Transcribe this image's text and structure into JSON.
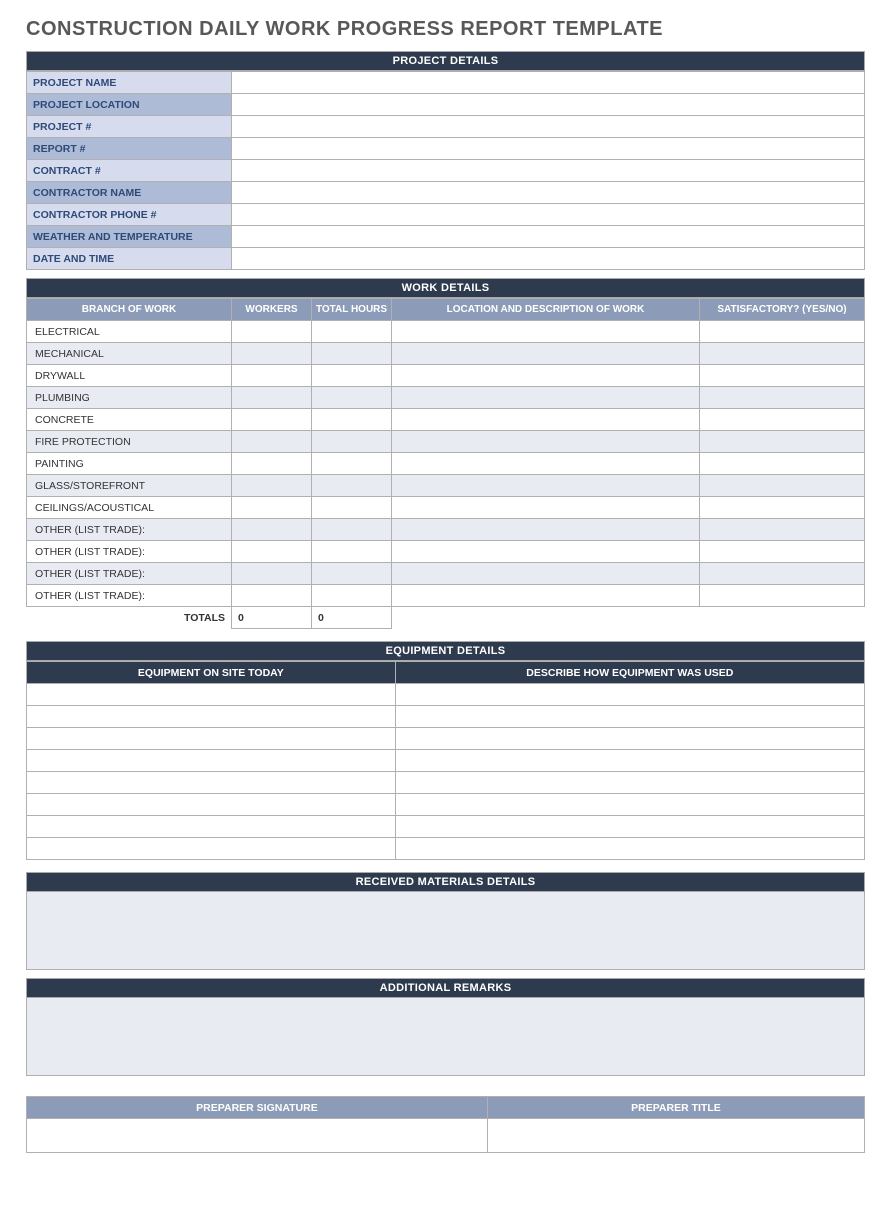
{
  "title": "CONSTRUCTION DAILY WORK PROGRESS REPORT TEMPLATE",
  "sections": {
    "project": "PROJECT DETAILS",
    "work": "WORK DETAILS",
    "equipment": "EQUIPMENT DETAILS",
    "materials": "RECEIVED MATERIALS DETAILS",
    "remarks": "ADDITIONAL REMARKS"
  },
  "project_fields": [
    {
      "label": "PROJECT NAME",
      "value": ""
    },
    {
      "label": "PROJECT LOCATION",
      "value": ""
    },
    {
      "label": "PROJECT #",
      "value": ""
    },
    {
      "label": "REPORT #",
      "value": ""
    },
    {
      "label": "CONTRACT #",
      "value": ""
    },
    {
      "label": "CONTRACTOR NAME",
      "value": ""
    },
    {
      "label": "CONTRACTOR PHONE #",
      "value": ""
    },
    {
      "label": "WEATHER AND TEMPERATURE",
      "value": ""
    },
    {
      "label": "DATE AND TIME",
      "value": ""
    }
  ],
  "work_columns": {
    "branch": "BRANCH OF WORK",
    "workers": "WORKERS",
    "hours": "TOTAL HOURS",
    "location": "LOCATION AND DESCRIPTION OF WORK",
    "satisfactory": "SATISFACTORY? (YES/NO)"
  },
  "work_rows": [
    {
      "branch": "ELECTRICAL",
      "workers": "",
      "hours": "",
      "location": "",
      "satisfactory": ""
    },
    {
      "branch": "MECHANICAL",
      "workers": "",
      "hours": "",
      "location": "",
      "satisfactory": ""
    },
    {
      "branch": "DRYWALL",
      "workers": "",
      "hours": "",
      "location": "",
      "satisfactory": ""
    },
    {
      "branch": "PLUMBING",
      "workers": "",
      "hours": "",
      "location": "",
      "satisfactory": ""
    },
    {
      "branch": "CONCRETE",
      "workers": "",
      "hours": "",
      "location": "",
      "satisfactory": ""
    },
    {
      "branch": "FIRE PROTECTION",
      "workers": "",
      "hours": "",
      "location": "",
      "satisfactory": ""
    },
    {
      "branch": "PAINTING",
      "workers": "",
      "hours": "",
      "location": "",
      "satisfactory": ""
    },
    {
      "branch": "GLASS/STOREFRONT",
      "workers": "",
      "hours": "",
      "location": "",
      "satisfactory": ""
    },
    {
      "branch": "CEILINGS/ACOUSTICAL",
      "workers": "",
      "hours": "",
      "location": "",
      "satisfactory": ""
    },
    {
      "branch": "OTHER (LIST TRADE):",
      "workers": "",
      "hours": "",
      "location": "",
      "satisfactory": ""
    },
    {
      "branch": "OTHER (LIST TRADE):",
      "workers": "",
      "hours": "",
      "location": "",
      "satisfactory": ""
    },
    {
      "branch": "OTHER (LIST TRADE):",
      "workers": "",
      "hours": "",
      "location": "",
      "satisfactory": ""
    },
    {
      "branch": "OTHER (LIST TRADE):",
      "workers": "",
      "hours": "",
      "location": "",
      "satisfactory": ""
    }
  ],
  "work_totals": {
    "label": "TOTALS",
    "workers": "0",
    "hours": "0"
  },
  "equipment_columns": {
    "onsite": "EQUIPMENT ON SITE TODAY",
    "usage": "DESCRIBE HOW EQUIPMENT WAS USED"
  },
  "equipment_rows": [
    {
      "onsite": "",
      "usage": ""
    },
    {
      "onsite": "",
      "usage": ""
    },
    {
      "onsite": "",
      "usage": ""
    },
    {
      "onsite": "",
      "usage": ""
    },
    {
      "onsite": "",
      "usage": ""
    },
    {
      "onsite": "",
      "usage": ""
    },
    {
      "onsite": "",
      "usage": ""
    },
    {
      "onsite": "",
      "usage": ""
    }
  ],
  "materials_text": "",
  "remarks_text": "",
  "signature": {
    "sig_label": "PREPARER SIGNATURE",
    "title_label": "PREPARER TITLE",
    "sig_value": "",
    "title_value": ""
  }
}
